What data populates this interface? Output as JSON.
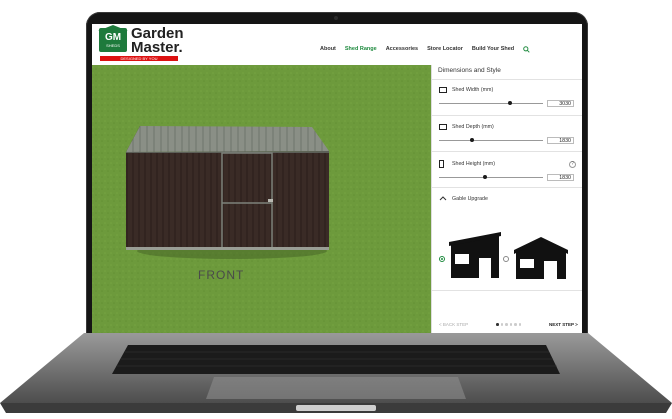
{
  "brand": {
    "logo_text": "GM",
    "logo_sub": "SHEDS",
    "name_line1": "Garden",
    "name_line2": "Master.",
    "tagline": "DESIGNED BY YOU"
  },
  "nav": {
    "items": [
      "About",
      "Shed Range",
      "Accessories",
      "Store Locator",
      "Build Your Shed"
    ],
    "active": "Shed Range",
    "search_icon": "search-icon"
  },
  "viewport": {
    "label": "FRONT"
  },
  "panel": {
    "title": "Dimensions and Style",
    "width": {
      "label": "Shed Width (mm)",
      "value": "3030",
      "level": 0.68
    },
    "depth": {
      "label": "Shed Depth (mm)",
      "value": "1830",
      "level": 0.32
    },
    "height": {
      "label": "Shed Height (mm)",
      "value": "1830",
      "level": 0.44
    },
    "gable": {
      "label": "Gable Upgrade",
      "options": [
        "standard",
        "gable"
      ],
      "selected": 0
    },
    "back_label": "< BACK STEP",
    "next_label": "NEXT STEP >",
    "steps_total": 6,
    "step_current": 1
  },
  "colors": {
    "brand_green": "#1e7a3c",
    "grass": "#6e9a3c",
    "shed_wall": "#3a2b26",
    "shed_roof": "#8a8f86"
  }
}
